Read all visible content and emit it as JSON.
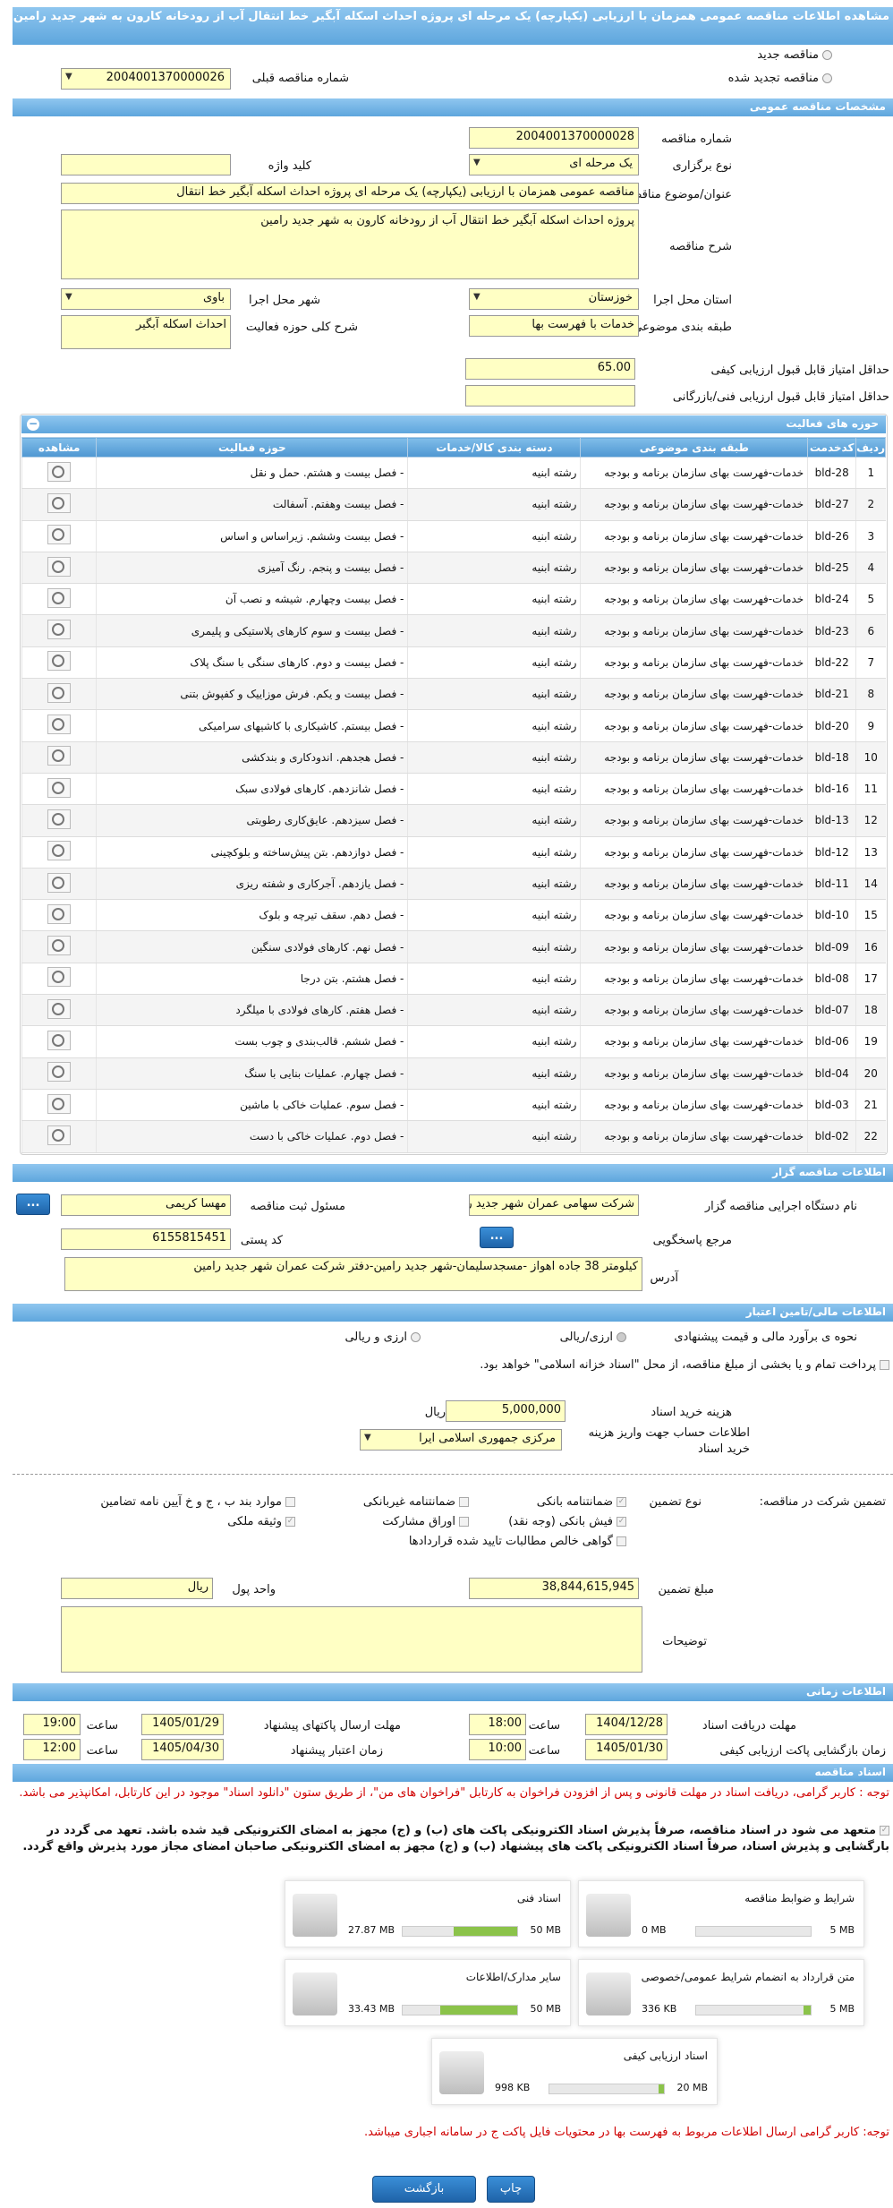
{
  "header": {
    "title": "مشاهده اطلاعات مناقصه عمومی همزمان با ارزیابی (یکپارچه) یک مرحله ای پروژه احداث اسکله آبگیر خط انتقال آب از رودخانه کارون به شهر جدید رامین"
  },
  "tender_type": {
    "new_label": "مناقصه جدید",
    "renewed_label": "مناقصه تجدید شده",
    "prev_number_label": "شماره مناقصه قبلی",
    "prev_number_value": "2004001370000026"
  },
  "general": {
    "section_title": "مشخصات مناقصه عمومی",
    "number_label": "شماره مناقصه",
    "number_value": "2004001370000028",
    "holding_type_label": "نوع برگزاری",
    "holding_type_value": "یک مرحله ای",
    "keyword_label": "کلید واژه",
    "keyword_value": "",
    "subject_label": "عنوان/موضوع مناقصه",
    "subject_value": "مناقصه عمومی همزمان با ارزیابی (یکپارچه) یک مرحله ای پروژه احداث اسکله آبگیر خط انتقال",
    "desc_label": "شرح مناقصه",
    "desc_value": "پروژه احداث اسکله آبگیر خط انتقال آب از رودخانه کارون به شهر جدید رامین",
    "province_label": "استان محل اجرا",
    "province_value": "خوزستان",
    "city_label": "شهر محل اجرا",
    "city_value": "باوی",
    "category_label": "طبقه بندی موضوعی",
    "category_value": "خدمات با فهرست بها",
    "scope_label": "شرح کلی حوزه فعالیت",
    "scope_value": "احداث اسکله آبگیر",
    "min_quality_label": "حداقل امتیاز قابل قبول ارزیابی کیفی",
    "min_quality_value": "65.00",
    "min_tech_label": "حداقل امتیاز قابل قبول ارزیابی فنی/بازرگانی",
    "min_tech_value": ""
  },
  "activities": {
    "section_title": "حوزه های فعالیت",
    "headers": [
      "ردیف",
      "کدخدمت",
      "طبقه بندی موضوعی",
      "دسته بندی کالا/خدمات",
      "حوزه فعالیت",
      "مشاهده"
    ],
    "type_text": "خدمات-فهرست بهای سازمان برنامه و بودجه",
    "group_text": "رشته ابنیه",
    "rows": [
      {
        "n": "1",
        "code": "bld-28",
        "act": "- فصل بیست و هشتم. حمل و نقل"
      },
      {
        "n": "2",
        "code": "bld-27",
        "act": "- فصل بیست وهفتم. آسفالت"
      },
      {
        "n": "3",
        "code": "bld-26",
        "act": "- فصل بیست وششم. زیراساس و اساس"
      },
      {
        "n": "4",
        "code": "bld-25",
        "act": "- فصل بیست و پنجم. رنگ آمیزی"
      },
      {
        "n": "5",
        "code": "bld-24",
        "act": "- فصل بیست وچهارم. شیشه و نصب آن"
      },
      {
        "n": "6",
        "code": "bld-23",
        "act": "- فصل بیست و سوم کارهای پلاستیکی و پلیمری"
      },
      {
        "n": "7",
        "code": "bld-22",
        "act": "- فصل بیست و دوم. کارهای سنگی با سنگ پلاک"
      },
      {
        "n": "8",
        "code": "bld-21",
        "act": "- فصل بیست و یکم. فرش موزاییک و کفپوش بتنی"
      },
      {
        "n": "9",
        "code": "bld-20",
        "act": "- فصل بیستم. کاشیکاری با کاشیهای سرامیکی"
      },
      {
        "n": "10",
        "code": "bld-18",
        "act": "- فصل هجدهم. اندودکاری و بندکشی"
      },
      {
        "n": "11",
        "code": "bld-16",
        "act": "- فصل شانزدهم. کارهای فولادی سبک"
      },
      {
        "n": "12",
        "code": "bld-13",
        "act": "- فصل سیزدهم. عایق‌کاری رطوبتی"
      },
      {
        "n": "13",
        "code": "bld-12",
        "act": "- فصل دوازدهم. بتن پیش‌ساخته و بلوکچینی"
      },
      {
        "n": "14",
        "code": "bld-11",
        "act": "- فصل یازدهم. آجرکاری و شفته ریزی"
      },
      {
        "n": "15",
        "code": "bld-10",
        "act": "- فصل دهم. سقف تیرچه و بلوک"
      },
      {
        "n": "16",
        "code": "bld-09",
        "act": "- فصل نهم. کارهای فولادی سنگین"
      },
      {
        "n": "17",
        "code": "bld-08",
        "act": "- فصل هشتم. بتن درجا"
      },
      {
        "n": "18",
        "code": "bld-07",
        "act": "- فصل هفتم. کارهای فولادی با میلگرد"
      },
      {
        "n": "19",
        "code": "bld-06",
        "act": "- فصل ششم. قالب‌بندی و چوب بست"
      },
      {
        "n": "20",
        "code": "bld-04",
        "act": "- فصل چهارم. عملیات بنایی با سنگ"
      },
      {
        "n": "21",
        "code": "bld-03",
        "act": "- فصل سوم. عملیات خاکی با ماشین"
      },
      {
        "n": "22",
        "code": "bld-02",
        "act": "- فصل دوم. عملیات خاکی با دست"
      }
    ]
  },
  "organizer": {
    "section_title": "اطلاعات مناقصه گزار",
    "org_label": "نام دستگاه اجرایی مناقصه گزار",
    "org_value": "شرکت سهامی عمران شهر جدید رامین",
    "officer_label": "مسئول ثبت مناقصه",
    "officer_value": "مهسا کریمی",
    "ref_label": "مرجع پاسخگویی",
    "postal_label": "کد پستی",
    "postal_value": "6155815451",
    "address_label": "آدرس",
    "address_value": "کیلومتر 38 جاده اهواز -مسجدسلیمان-شهر جدید رامین-دفتر شرکت عمران شهر جدید رامین",
    "dots": "..."
  },
  "finance": {
    "section_title": "اطلاعات مالی/تامین اعتبار",
    "estimate_label": "نحوه ی برآورد مالی و قیمت پیشنهادی",
    "opt_rial": "ارزی/ریالی",
    "opt_forex": "ارزی و ریالی",
    "treasury_text": "پرداخت تمام و یا بخشی از مبلغ مناقصه، از محل \"اسناد خزانه اسلامی\" خواهد بود.",
    "doc_fee_label": "هزینه خرید اسناد",
    "doc_fee_value": "5,000,000",
    "doc_fee_unit": "ریال",
    "account_label": "اطلاعات حساب جهت واریز هزینه خرید اسناد",
    "account_value": "مرکزی جمهوری اسلامی ایرا"
  },
  "guarantee": {
    "participate_label": "تضمین شرکت در مناقصه:",
    "type_label": "نوع تضمین",
    "options": [
      "ضمانتنامه بانکی",
      "ضمانتنامه غیربانکی",
      "موارد بند ب ، ج و خ آیین نامه تضامین",
      "فیش بانکی (وجه نقد)",
      "اوراق مشارکت",
      "وثیقه ملکی",
      "گواهی خالص مطالبات تایید شده قراردادها"
    ],
    "amount_label": "مبلغ تضمین",
    "amount_value": "38,844,615,945",
    "currency_label": "واحد پول",
    "currency_value": "ریال",
    "notes_label": "توضیحات",
    "notes_value": ""
  },
  "timing": {
    "section_title": "اطلاعات زمانی",
    "receive_label": "مهلت دریافت اسناد",
    "receive_date": "1404/12/28",
    "receive_time": "18:00",
    "submit_label": "مهلت ارسال پاکتهای پیشنهاد",
    "submit_date": "1405/01/29",
    "submit_time": "19:00",
    "open_label": "زمان بازگشایی پاکت ارزیابی کیفی",
    "open_date": "1405/01/30",
    "open_time": "10:00",
    "validity_label": "زمان اعتبار پیشنهاد",
    "validity_date": "1405/04/30",
    "validity_time": "12:00",
    "time_label": "ساعت"
  },
  "docs": {
    "section_title": "اسناد مناقصه",
    "note1": "توجه : کاربر گرامی، دریافت اسناد در مهلت قانونی و پس از افزودن فراخوان به کارتابل \"فراخوان های من\"، از طریق ستون \"دانلود اسناد\" موجود در این کارتابل، امکانپذیر می باشد.",
    "commit_text": "متعهد می شود در اسناد مناقصه، صرفاً پذیرش اسناد الکترونیکی پاکت های (ب) و (ج) مجهز به امضای الکترونیکی قید شده باشد. تعهد می گردد در بارگشایی و پذیرش اسناد، صرفاً اسناد الکترونیکی پاکت های پیشنهاد (ب) و (ج) مجهز به امضای الکترونیکی صاحبان امضای مجاز مورد پذیرش واقع گردد.",
    "files": [
      {
        "name": "شرایط و ضوابط مناقصه",
        "used": "0 MB",
        "max": "5 MB",
        "pct": 0
      },
      {
        "name": "اسناد فنی",
        "used": "27.87 MB",
        "max": "50 MB",
        "pct": 0.557
      },
      {
        "name": "متن قرارداد به انضمام شرایط عمومی/خصوصی",
        "used": "336 KB",
        "max": "5 MB",
        "pct": 0.066
      },
      {
        "name": "سایر مدارک/اطلاعات",
        "used": "33.43 MB",
        "max": "50 MB",
        "pct": 0.669
      },
      {
        "name": "اسناد ارزیابی کیفی",
        "used": "998 KB",
        "max": "20 MB",
        "pct": 0.049
      }
    ],
    "note2": "توجه: کاربر گرامی ارسال اطلاعات مربوط به فهرست بها در محتویات فایل پاکت ج در سامانه اجباری میباشد."
  },
  "footer": {
    "print_label": "چاپ",
    "back_label": "بازگشت"
  }
}
